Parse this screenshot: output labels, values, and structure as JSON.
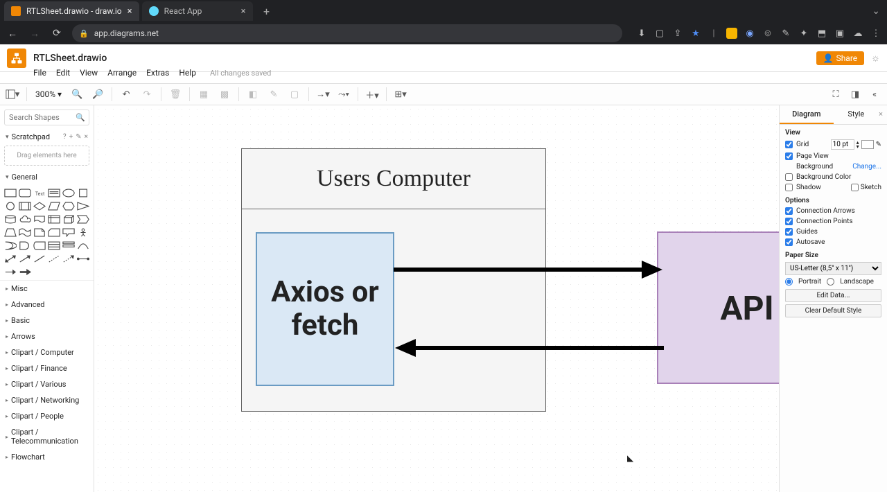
{
  "browser": {
    "tabs": [
      {
        "title": "RTLSheet.drawio - draw.io",
        "active": true
      },
      {
        "title": "React App",
        "active": false
      }
    ],
    "url": "app.diagrams.net"
  },
  "doc": {
    "title": "RTLSheet.drawio",
    "menus": [
      "File",
      "Edit",
      "View",
      "Arrange",
      "Extras",
      "Help"
    ],
    "status": "All changes saved",
    "share": "Share"
  },
  "toolbar": {
    "zoom": "300%"
  },
  "left": {
    "search_placeholder": "Search Shapes",
    "scratchpad": "Scratchpad",
    "scratch_drop": "Drag elements here",
    "general": "General",
    "categories": [
      "Misc",
      "Advanced",
      "Basic",
      "Arrows",
      "Clipart / Computer",
      "Clipart / Finance",
      "Clipart / Various",
      "Clipart / Networking",
      "Clipart / People",
      "Clipart / Telecommunication",
      "Flowchart"
    ]
  },
  "right": {
    "tabs": [
      "Diagram",
      "Style"
    ],
    "view": "View",
    "grid": "Grid",
    "grid_val": "10 pt",
    "pageview": "Page View",
    "background": "Background",
    "change": "Change...",
    "bgcolor": "Background Color",
    "shadow": "Shadow",
    "sketch": "Sketch",
    "options": "Options",
    "conn_arrows": "Connection Arrows",
    "conn_points": "Connection Points",
    "guides": "Guides",
    "autosave": "Autosave",
    "papersize": "Paper Size",
    "paper_sel": "US-Letter (8,5\" x 11\")",
    "portrait": "Portrait",
    "landscape": "Landscape",
    "editdata": "Edit Data...",
    "cleardef": "Clear Default Style"
  },
  "diagram": {
    "container_title": "Users Computer",
    "axios": "Axios or fetch",
    "api": "API"
  }
}
